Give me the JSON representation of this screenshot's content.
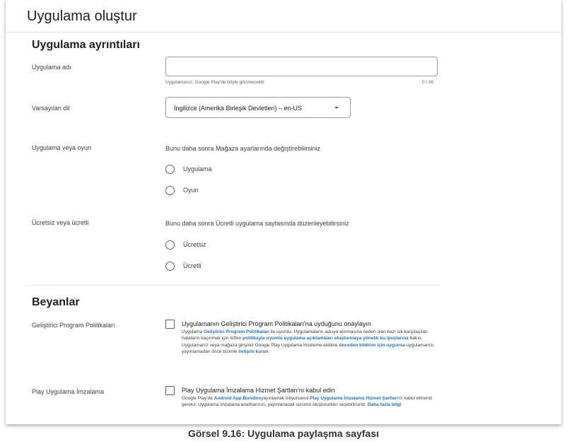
{
  "header": {
    "title": "Uygulama oluştur"
  },
  "details": {
    "section_title": "Uygulama ayrıntıları",
    "app_name": {
      "label": "Uygulama adı",
      "value": "",
      "helper": "Uygulamanız, Google Play'de böyle görünecektir",
      "counter": "0 / 30"
    },
    "default_language": {
      "label": "Varsayılan dil",
      "selected": "İngilizce (Amerika Birleşik Devletleri) – en-US"
    },
    "app_or_game": {
      "label": "Uygulama veya oyun",
      "hint": "Bunu daha sonra Mağaza ayarlarında değiştirebilirsiniz",
      "options": [
        "Uygulama",
        "Oyun"
      ]
    },
    "free_or_paid": {
      "label": "Ücretsiz veya ücretli",
      "hint": "Bunu daha sonra Ücretli uygulama sayfasında düzenleyebilirsiniz",
      "options": [
        "Ücretsiz",
        "Ücretli"
      ]
    }
  },
  "declarations": {
    "section_title": "Beyanlar",
    "developer_policies": {
      "label": "Geliştirici Program Politikaları",
      "title": "Uygulamanın Geliştirici Program Politikaları'na uyduğunu onaylayın",
      "b1": "Uygulama ",
      "l1": "Geliştirici Program Politikaları",
      "b2": " ile uyumlu. Uygulamaların askıya alınmasına neden olan bazı sık karşılaşılan hataların kaçınmak için lütfen ",
      "l2": "politikayla uyumlu uygulama açıklamaları oluşturmaya yönelik bu ipuçlarına",
      "b3": " bakın. Uygulamanız veya mağaza girişiniz Google Play Uygulama İnceleme ekibine ",
      "l3": "önceden bildirim için uygunsa",
      "b4": " uygulamanızı yayınlamadan önce bizimle ",
      "l4": "iletişim kurun",
      "b5": "."
    },
    "play_signing": {
      "label": "Play Uygulama İmzalama",
      "title": "Play Uygulama İmzalama Hizmet Şartları'nı kabul edin",
      "b1": "Google Play'de ",
      "l1": "Android App Bundles",
      "b2": "yayınlamak istiyorsanız ",
      "l2": "Play Uygulama İmzalama Hizmet Şartları",
      "b3": "'nı kabul etmeniz gerekir. Uygulama imzalama anahtarınızı, yayınlanacak sürümü oluştururken seçebilirsiniz. ",
      "l3": "Daha fazla bilgi"
    }
  },
  "caption": "Görsel 9.16: Uygulama paylaşma sayfası"
}
